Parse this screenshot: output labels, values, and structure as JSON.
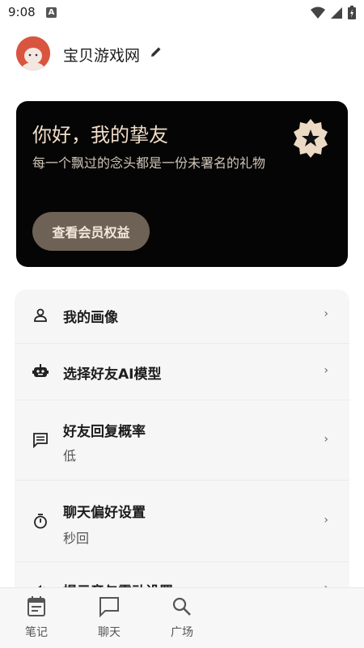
{
  "status_bar": {
    "time": "9:08",
    "indicator": "A"
  },
  "header": {
    "site_name": "宝贝游戏网",
    "icons": [
      "avatar",
      "pencil-icon"
    ]
  },
  "vip_card": {
    "title": "你好，我的挚友",
    "subtitle": "每一个飘过的念头都是一份未署名的礼物",
    "button_label": "查看会员权益",
    "icon": "star-badge-icon"
  },
  "settings": [
    {
      "label": "我的画像",
      "value": "",
      "icon": "person-icon"
    },
    {
      "label": "选择好友AI模型",
      "value": "",
      "icon": "robot-icon"
    },
    {
      "label": "好友回复概率",
      "value": "低",
      "icon": "chat-lines-icon"
    },
    {
      "label": "聊天偏好设置",
      "value": "秒回",
      "icon": "timer-icon"
    },
    {
      "label": "提示音与震动设置",
      "value": "",
      "icon": "volume-icon"
    }
  ],
  "bottom_nav": [
    {
      "label": "笔记",
      "icon": "notebook-icon"
    },
    {
      "label": "聊天",
      "icon": "chat-bubble-icon"
    },
    {
      "label": "广场",
      "icon": "search-icon"
    }
  ],
  "colors": {
    "card_bg": "#050505",
    "gold_text": "#f1ddc8",
    "button_bg": "#6e6256",
    "avatar": "#d9553f"
  }
}
